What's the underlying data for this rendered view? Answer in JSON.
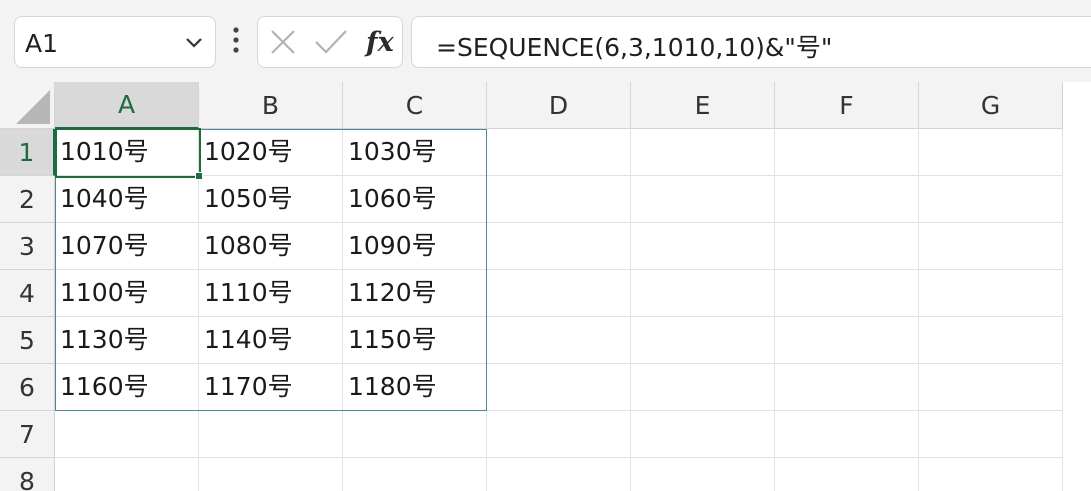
{
  "formula_bar": {
    "name_box": "A1",
    "formula": "=SEQUENCE(6,3,1010,10)&\"号\"",
    "fx_label": "fx"
  },
  "columns": [
    "A",
    "B",
    "C",
    "D",
    "E",
    "F",
    "G"
  ],
  "rows": [
    "1",
    "2",
    "3",
    "4",
    "5",
    "6",
    "7",
    "8"
  ],
  "cells": [
    [
      "1010号",
      "1020号",
      "1030号"
    ],
    [
      "1040号",
      "1050号",
      "1060号"
    ],
    [
      "1070号",
      "1080号",
      "1090号"
    ],
    [
      "1100号",
      "1110号",
      "1120号"
    ],
    [
      "1130号",
      "1140号",
      "1150号"
    ],
    [
      "1160号",
      "1170号",
      "1180号"
    ]
  ],
  "colors": {
    "selection": "#1e6b40",
    "spill_border": "#4a8b9a"
  },
  "icons": [
    "chevron-down-icon",
    "more-options-icon",
    "cancel-icon",
    "enter-icon"
  ]
}
